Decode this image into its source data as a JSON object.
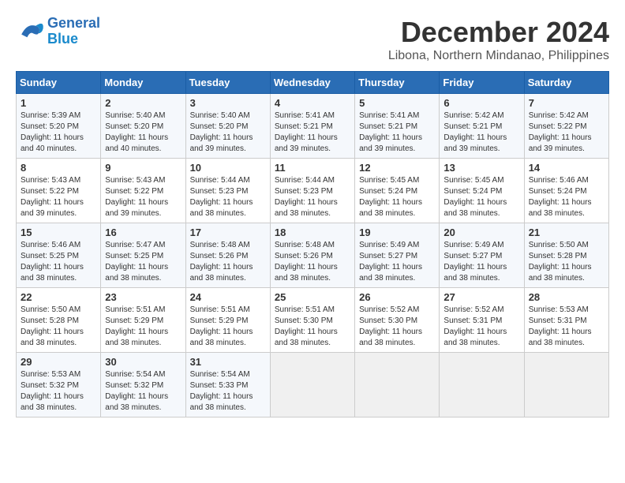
{
  "logo": {
    "line1": "General",
    "line2": "Blue"
  },
  "title": "December 2024",
  "subtitle": "Libona, Northern Mindanao, Philippines",
  "header": {
    "days": [
      "Sunday",
      "Monday",
      "Tuesday",
      "Wednesday",
      "Thursday",
      "Friday",
      "Saturday"
    ]
  },
  "weeks": [
    {
      "cells": [
        {
          "day": "1",
          "sunrise": "5:39 AM",
          "sunset": "5:20 PM",
          "daylight": "11 hours and 40 minutes."
        },
        {
          "day": "2",
          "sunrise": "5:40 AM",
          "sunset": "5:20 PM",
          "daylight": "11 hours and 40 minutes."
        },
        {
          "day": "3",
          "sunrise": "5:40 AM",
          "sunset": "5:20 PM",
          "daylight": "11 hours and 39 minutes."
        },
        {
          "day": "4",
          "sunrise": "5:41 AM",
          "sunset": "5:21 PM",
          "daylight": "11 hours and 39 minutes."
        },
        {
          "day": "5",
          "sunrise": "5:41 AM",
          "sunset": "5:21 PM",
          "daylight": "11 hours and 39 minutes."
        },
        {
          "day": "6",
          "sunrise": "5:42 AM",
          "sunset": "5:21 PM",
          "daylight": "11 hours and 39 minutes."
        },
        {
          "day": "7",
          "sunrise": "5:42 AM",
          "sunset": "5:22 PM",
          "daylight": "11 hours and 39 minutes."
        }
      ]
    },
    {
      "cells": [
        {
          "day": "8",
          "sunrise": "5:43 AM",
          "sunset": "5:22 PM",
          "daylight": "11 hours and 39 minutes."
        },
        {
          "day": "9",
          "sunrise": "5:43 AM",
          "sunset": "5:22 PM",
          "daylight": "11 hours and 39 minutes."
        },
        {
          "day": "10",
          "sunrise": "5:44 AM",
          "sunset": "5:23 PM",
          "daylight": "11 hours and 38 minutes."
        },
        {
          "day": "11",
          "sunrise": "5:44 AM",
          "sunset": "5:23 PM",
          "daylight": "11 hours and 38 minutes."
        },
        {
          "day": "12",
          "sunrise": "5:45 AM",
          "sunset": "5:24 PM",
          "daylight": "11 hours and 38 minutes."
        },
        {
          "day": "13",
          "sunrise": "5:45 AM",
          "sunset": "5:24 PM",
          "daylight": "11 hours and 38 minutes."
        },
        {
          "day": "14",
          "sunrise": "5:46 AM",
          "sunset": "5:24 PM",
          "daylight": "11 hours and 38 minutes."
        }
      ]
    },
    {
      "cells": [
        {
          "day": "15",
          "sunrise": "5:46 AM",
          "sunset": "5:25 PM",
          "daylight": "11 hours and 38 minutes."
        },
        {
          "day": "16",
          "sunrise": "5:47 AM",
          "sunset": "5:25 PM",
          "daylight": "11 hours and 38 minutes."
        },
        {
          "day": "17",
          "sunrise": "5:48 AM",
          "sunset": "5:26 PM",
          "daylight": "11 hours and 38 minutes."
        },
        {
          "day": "18",
          "sunrise": "5:48 AM",
          "sunset": "5:26 PM",
          "daylight": "11 hours and 38 minutes."
        },
        {
          "day": "19",
          "sunrise": "5:49 AM",
          "sunset": "5:27 PM",
          "daylight": "11 hours and 38 minutes."
        },
        {
          "day": "20",
          "sunrise": "5:49 AM",
          "sunset": "5:27 PM",
          "daylight": "11 hours and 38 minutes."
        },
        {
          "day": "21",
          "sunrise": "5:50 AM",
          "sunset": "5:28 PM",
          "daylight": "11 hours and 38 minutes."
        }
      ]
    },
    {
      "cells": [
        {
          "day": "22",
          "sunrise": "5:50 AM",
          "sunset": "5:28 PM",
          "daylight": "11 hours and 38 minutes."
        },
        {
          "day": "23",
          "sunrise": "5:51 AM",
          "sunset": "5:29 PM",
          "daylight": "11 hours and 38 minutes."
        },
        {
          "day": "24",
          "sunrise": "5:51 AM",
          "sunset": "5:29 PM",
          "daylight": "11 hours and 38 minutes."
        },
        {
          "day": "25",
          "sunrise": "5:51 AM",
          "sunset": "5:30 PM",
          "daylight": "11 hours and 38 minutes."
        },
        {
          "day": "26",
          "sunrise": "5:52 AM",
          "sunset": "5:30 PM",
          "daylight": "11 hours and 38 minutes."
        },
        {
          "day": "27",
          "sunrise": "5:52 AM",
          "sunset": "5:31 PM",
          "daylight": "11 hours and 38 minutes."
        },
        {
          "day": "28",
          "sunrise": "5:53 AM",
          "sunset": "5:31 PM",
          "daylight": "11 hours and 38 minutes."
        }
      ]
    },
    {
      "cells": [
        {
          "day": "29",
          "sunrise": "5:53 AM",
          "sunset": "5:32 PM",
          "daylight": "11 hours and 38 minutes."
        },
        {
          "day": "30",
          "sunrise": "5:54 AM",
          "sunset": "5:32 PM",
          "daylight": "11 hours and 38 minutes."
        },
        {
          "day": "31",
          "sunrise": "5:54 AM",
          "sunset": "5:33 PM",
          "daylight": "11 hours and 38 minutes."
        },
        null,
        null,
        null,
        null
      ]
    }
  ],
  "labels": {
    "sunrise": "Sunrise: ",
    "sunset": "Sunset: ",
    "daylight": "Daylight: "
  }
}
